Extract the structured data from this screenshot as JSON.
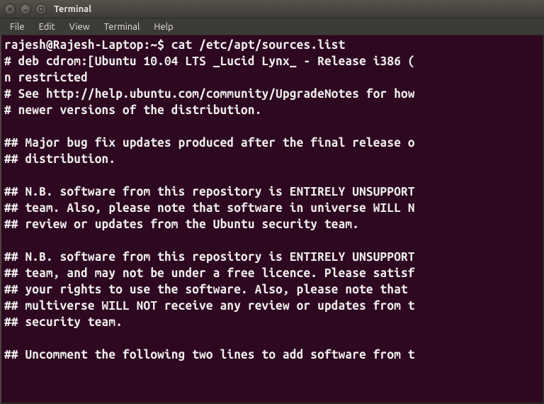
{
  "window": {
    "title": "Terminal"
  },
  "menubar": {
    "items": [
      "File",
      "Edit",
      "View",
      "Terminal",
      "Help"
    ]
  },
  "terminal": {
    "prompt": "rajesh@Rajesh-Laptop:~$ ",
    "command": "cat /etc/apt/sources.list",
    "output_lines": [
      "# deb cdrom:[Ubuntu 10.04 LTS _Lucid Lynx_ - Release i386 (",
      "n restricted",
      "# See http://help.ubuntu.com/community/UpgradeNotes for how",
      "# newer versions of the distribution.",
      "",
      "## Major bug fix updates produced after the final release o",
      "## distribution.",
      "",
      "## N.B. software from this repository is ENTIRELY UNSUPPORT",
      "## team. Also, please note that software in universe WILL N",
      "## review or updates from the Ubuntu security team.",
      "",
      "## N.B. software from this repository is ENTIRELY UNSUPPORT",
      "## team, and may not be under a free licence. Please satisf",
      "## your rights to use the software. Also, please note that ",
      "## multiverse WILL NOT receive any review or updates from t",
      "## security team.",
      "",
      "## Uncomment the following two lines to add software from t"
    ]
  }
}
